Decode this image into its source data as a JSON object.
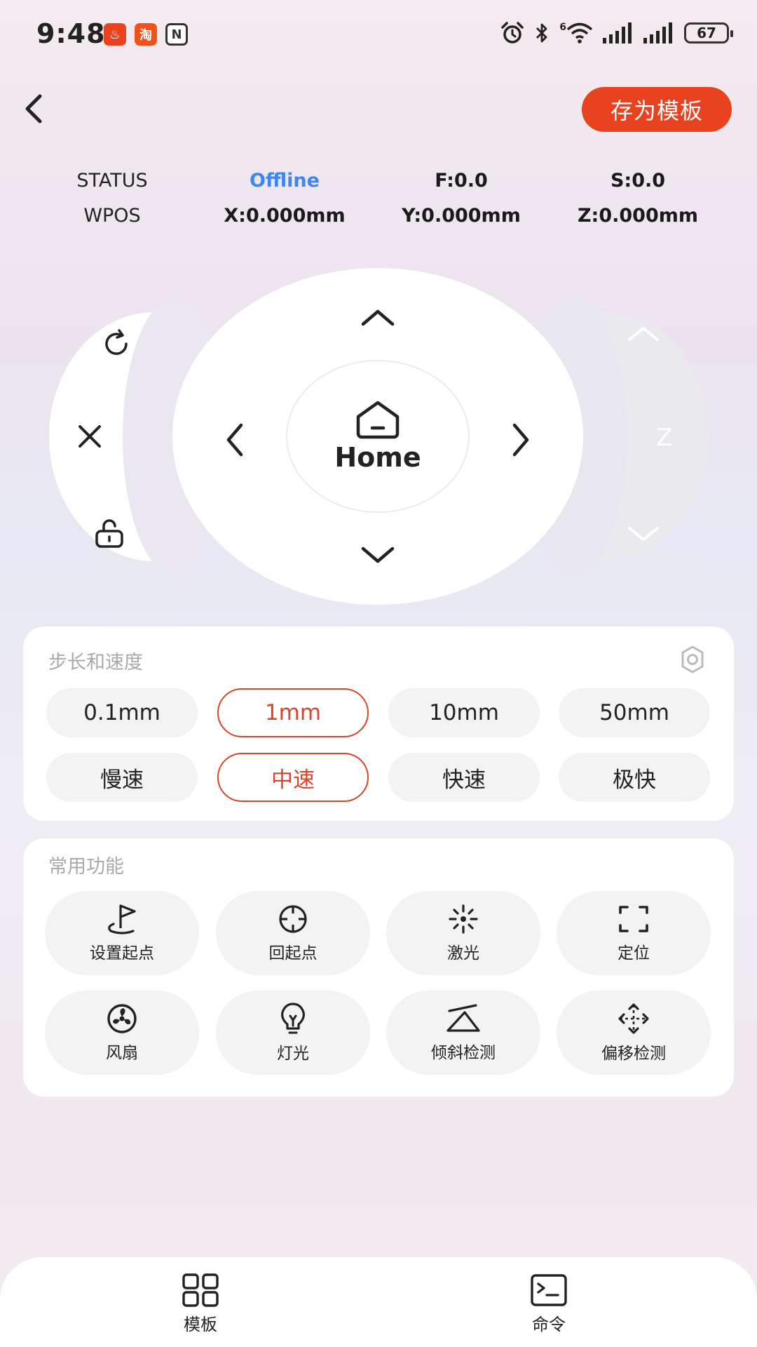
{
  "status_bar": {
    "time": "9:48",
    "app_icons": [
      {
        "name": "app-icon-red",
        "glyph": "♨",
        "color": "#e9421f"
      },
      {
        "name": "taobao-icon",
        "glyph": "淘",
        "color": "#f0521c"
      },
      {
        "name": "nfc-icon",
        "glyph": "N",
        "color": "#333333"
      }
    ],
    "battery": "67",
    "network_label": "6"
  },
  "header": {
    "save_template_label": "存为模板"
  },
  "machine_status": {
    "status_label": "STATUS",
    "status_value": "Offline",
    "feed": "F:0.0",
    "spindle": "S:0.0",
    "wpos_label": "WPOS",
    "x": "X:0.000mm",
    "y": "Y:0.000mm",
    "z": "Z:0.000mm"
  },
  "jog": {
    "home_label": "Home",
    "z_label": "Z"
  },
  "step_speed": {
    "title": "步长和速度",
    "steps": [
      "0.1mm",
      "1mm",
      "10mm",
      "50mm"
    ],
    "selected_step": "1mm",
    "speeds": [
      "慢速",
      "中速",
      "快速",
      "极快"
    ],
    "selected_speed": "中速"
  },
  "functions": {
    "title": "常用功能",
    "items": [
      {
        "label": "设置起点",
        "icon": "flag-icon"
      },
      {
        "label": "回起点",
        "icon": "crosshair-icon"
      },
      {
        "label": "激光",
        "icon": "laser-icon"
      },
      {
        "label": "定位",
        "icon": "focus-frame-icon"
      },
      {
        "label": "风扇",
        "icon": "fan-icon"
      },
      {
        "label": "灯光",
        "icon": "bulb-icon"
      },
      {
        "label": "倾斜检测",
        "icon": "tilt-icon"
      },
      {
        "label": "偏移检测",
        "icon": "move-arrows-icon"
      }
    ]
  },
  "bottom_nav": {
    "templates_label": "模板",
    "commands_label": "命令"
  },
  "colors": {
    "accent": "#e9421f",
    "selected_outline": "#d6462c",
    "offline_blue": "#3f86f0"
  }
}
